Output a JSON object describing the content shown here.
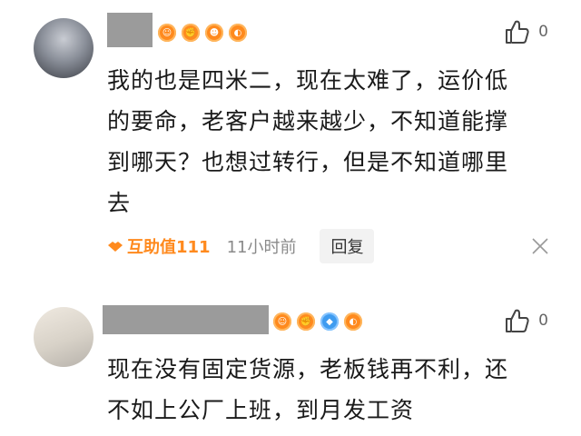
{
  "comments": [
    {
      "text_lines": [
        "我的也是四米二，现在太难了，运价低",
        "的要命，老客户越来越少，不知道能撑",
        "到哪天？也想过转行，但是不知道哪里",
        "去"
      ],
      "likes": "0",
      "helper_label": "互助值111",
      "time": "11小时前",
      "reply_label": "回复",
      "badges": [
        {
          "icon": "medal-icon",
          "color": "#ff8a1e"
        },
        {
          "icon": "fist-icon",
          "color": "#ff8a1e"
        },
        {
          "icon": "face-icon",
          "color": "#ff8a1e"
        },
        {
          "icon": "medal-icon",
          "color": "#ff8a1e"
        }
      ]
    },
    {
      "text_lines": [
        "现在没有固定货源，老板钱再不利，还",
        "不如上公厂上班，到月发工资"
      ],
      "likes": "0",
      "badges": [
        {
          "icon": "medal-icon",
          "color": "#ff8a1e"
        },
        {
          "icon": "fist-icon",
          "color": "#ff8a1e"
        },
        {
          "icon": "diamond-icon",
          "color": "#3f9cf0"
        },
        {
          "icon": "medal-icon",
          "color": "#ff8a1e"
        }
      ]
    }
  ]
}
